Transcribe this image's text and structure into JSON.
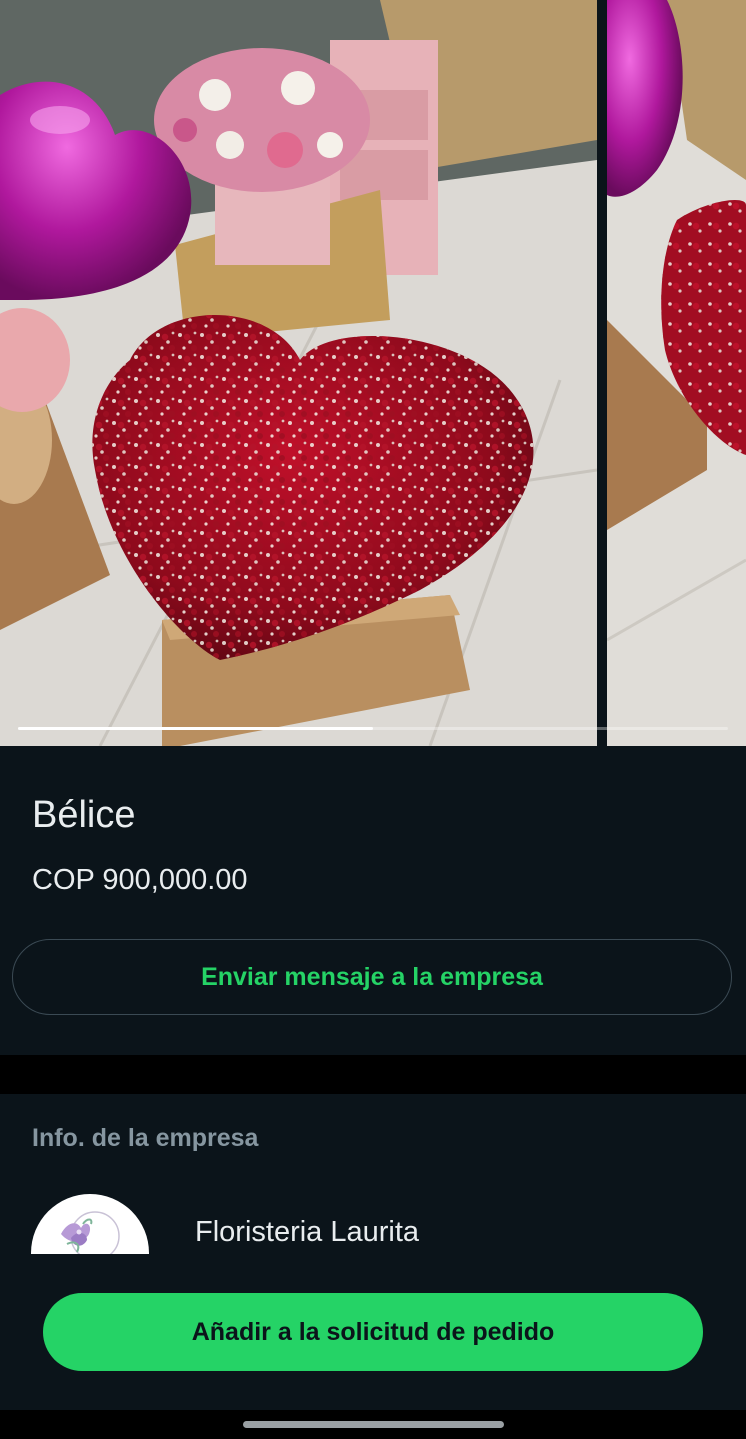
{
  "product": {
    "title": "Bélice",
    "price": "COP 900,000.00",
    "message_button_label": "Enviar mensaje a la empresa",
    "images": [
      {
        "subject": "heart-shaped-red-rose-arrangement"
      },
      {
        "subject": "red-rose-arrangement-alternate-view"
      }
    ],
    "gallery_position": 1,
    "gallery_count": 2
  },
  "business": {
    "section_heading": "Info. de la empresa",
    "name": "Floristeria Laurita",
    "avatar_icon": "floral-logo-icon"
  },
  "order": {
    "button_label": "Añadir a la solicitud de pedido"
  },
  "colors": {
    "accent": "#25d366",
    "background": "#0b141a",
    "separator": "#000000",
    "text_primary": "#e9edef",
    "text_secondary": "#8696a0"
  }
}
